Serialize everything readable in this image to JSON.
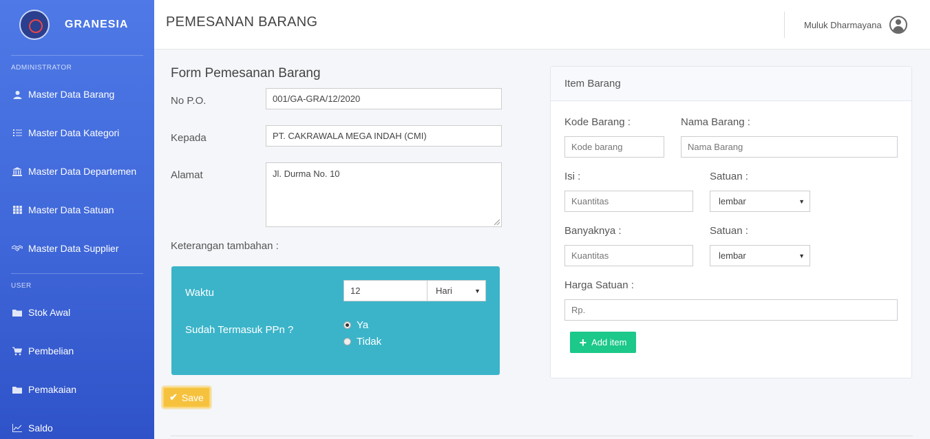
{
  "brand": {
    "name": "GRANESIA"
  },
  "sidebar": {
    "sections": [
      {
        "title": "ADMINISTRATOR",
        "items": [
          {
            "label": "Master Data Barang",
            "icon": "user-icon"
          },
          {
            "label": "Master Data Kategori",
            "icon": "list-icon"
          },
          {
            "label": "Master Data Departemen",
            "icon": "bank-icon"
          },
          {
            "label": "Master Data Satuan",
            "icon": "grid-icon"
          },
          {
            "label": "Master Data Supplier",
            "icon": "handshake-icon"
          }
        ]
      },
      {
        "title": "USER",
        "items": [
          {
            "label": "Stok Awal",
            "icon": "folder-icon"
          },
          {
            "label": "Pembelian",
            "icon": "cart-icon"
          },
          {
            "label": "Pemakaian",
            "icon": "folder-icon"
          },
          {
            "label": "Saldo",
            "icon": "chart-icon"
          }
        ]
      }
    ]
  },
  "header": {
    "title": "PEMESANAN BARANG",
    "user_name": "Muluk Dharmayana"
  },
  "form": {
    "title": "Form Pemesanan Barang",
    "no_po_label": "No P.O.",
    "no_po_value": "001/GA-GRA/12/2020",
    "kepada_label": "Kepada",
    "kepada_value": "PT. CAKRAWALA MEGA INDAH (CMI)",
    "alamat_label": "Alamat",
    "alamat_value": "Jl. Durma No. 10",
    "keterangan_label": "Keterangan tambahan :",
    "waktu_label": "Waktu",
    "waktu_value": "12",
    "waktu_unit": "Hari",
    "ppn_label": "Sudah Termasuk PPn ?",
    "ppn_yes": "Ya",
    "ppn_no": "Tidak",
    "save_label": "Save"
  },
  "item_card": {
    "title": "Item Barang",
    "kode_label": "Kode Barang :",
    "kode_placeholder": "Kode barang",
    "nama_label": "Nama Barang :",
    "nama_placeholder": "Nama Barang",
    "isi_label": "Isi :",
    "isi_placeholder": "Kuantitas",
    "satuan1_label": "Satuan :",
    "satuan1_value": "lembar",
    "banyaknya_label": "Banyaknya :",
    "banyaknya_placeholder": "Kuantitas",
    "satuan2_label": "Satuan :",
    "satuan2_value": "lembar",
    "harga_label": "Harga Satuan :",
    "harga_placeholder": "Rp.",
    "add_label": "Add item"
  },
  "colors": {
    "sidebar": "#4e79e6",
    "teal_panel": "#3bb4c9",
    "save": "#f6c23e",
    "add": "#1cc88a"
  }
}
